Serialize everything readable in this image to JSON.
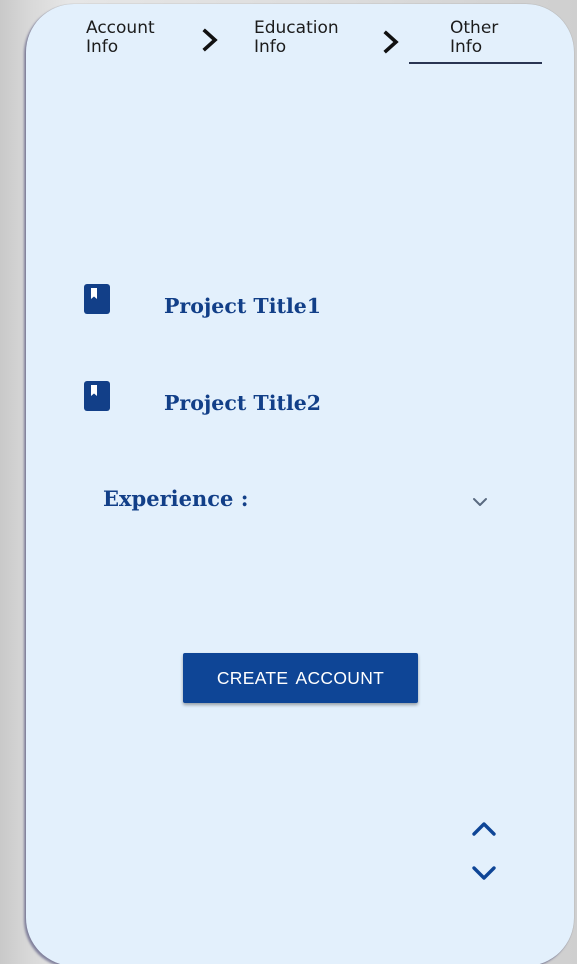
{
  "stepper": {
    "steps": [
      {
        "line1": "Account",
        "line2": "Info"
      },
      {
        "line1": "Education",
        "line2": "Info"
      },
      {
        "line1": "Other",
        "line2": "Info"
      }
    ],
    "active_step": 3,
    "separator_icon": "chevron-right-icon"
  },
  "projects": [
    {
      "icon": "bookmark-icon",
      "title": "Project Title1"
    },
    {
      "icon": "bookmark-icon",
      "title": "Project Title2"
    }
  ],
  "experience": {
    "label": "Experience :",
    "dropdown_icon": "chevron-down-icon"
  },
  "create_account": {
    "label": "CREATE  ACCOUNT"
  },
  "scroll_controls": {
    "up_icon": "chevron-up-icon",
    "down_icon": "chevron-down-icon"
  },
  "colors": {
    "background": "#e3f0fc",
    "accent": "#0e4596",
    "title_text": "#123f88",
    "step_text": "#1c1c1c"
  }
}
